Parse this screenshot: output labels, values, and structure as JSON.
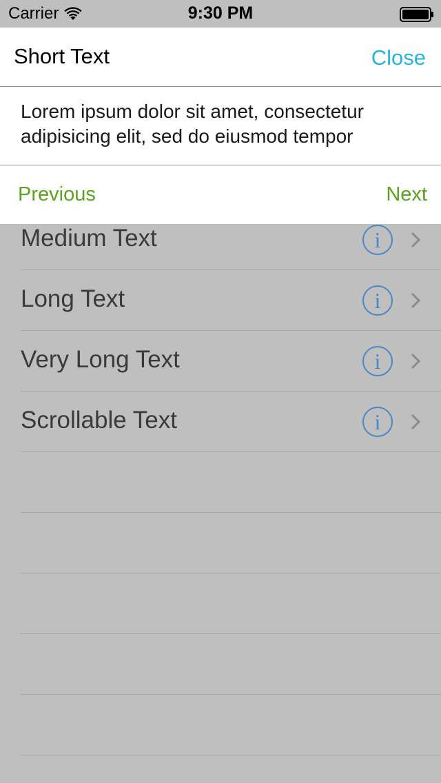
{
  "status_bar": {
    "carrier": "Carrier",
    "time": "9:30 PM"
  },
  "sheet": {
    "title": "Short Text",
    "close_label": "Close",
    "body_text": "Lorem ipsum dolor sit amet, consectetur adipisicing elit, sed do eiusmod tempor",
    "previous_label": "Previous",
    "next_label": "Next"
  },
  "list": {
    "items": [
      {
        "label": "Medium Text"
      },
      {
        "label": "Long Text"
      },
      {
        "label": "Very Long Text"
      },
      {
        "label": "Scrollable Text"
      },
      {
        "label": ""
      },
      {
        "label": ""
      },
      {
        "label": ""
      },
      {
        "label": ""
      },
      {
        "label": ""
      }
    ],
    "info_glyph": "i"
  },
  "colors": {
    "accent_close": "#27b4e0",
    "accent_nav": "#5ba31e",
    "info_icon": "#4a86c8",
    "dim_background": "#bfbfbf"
  }
}
